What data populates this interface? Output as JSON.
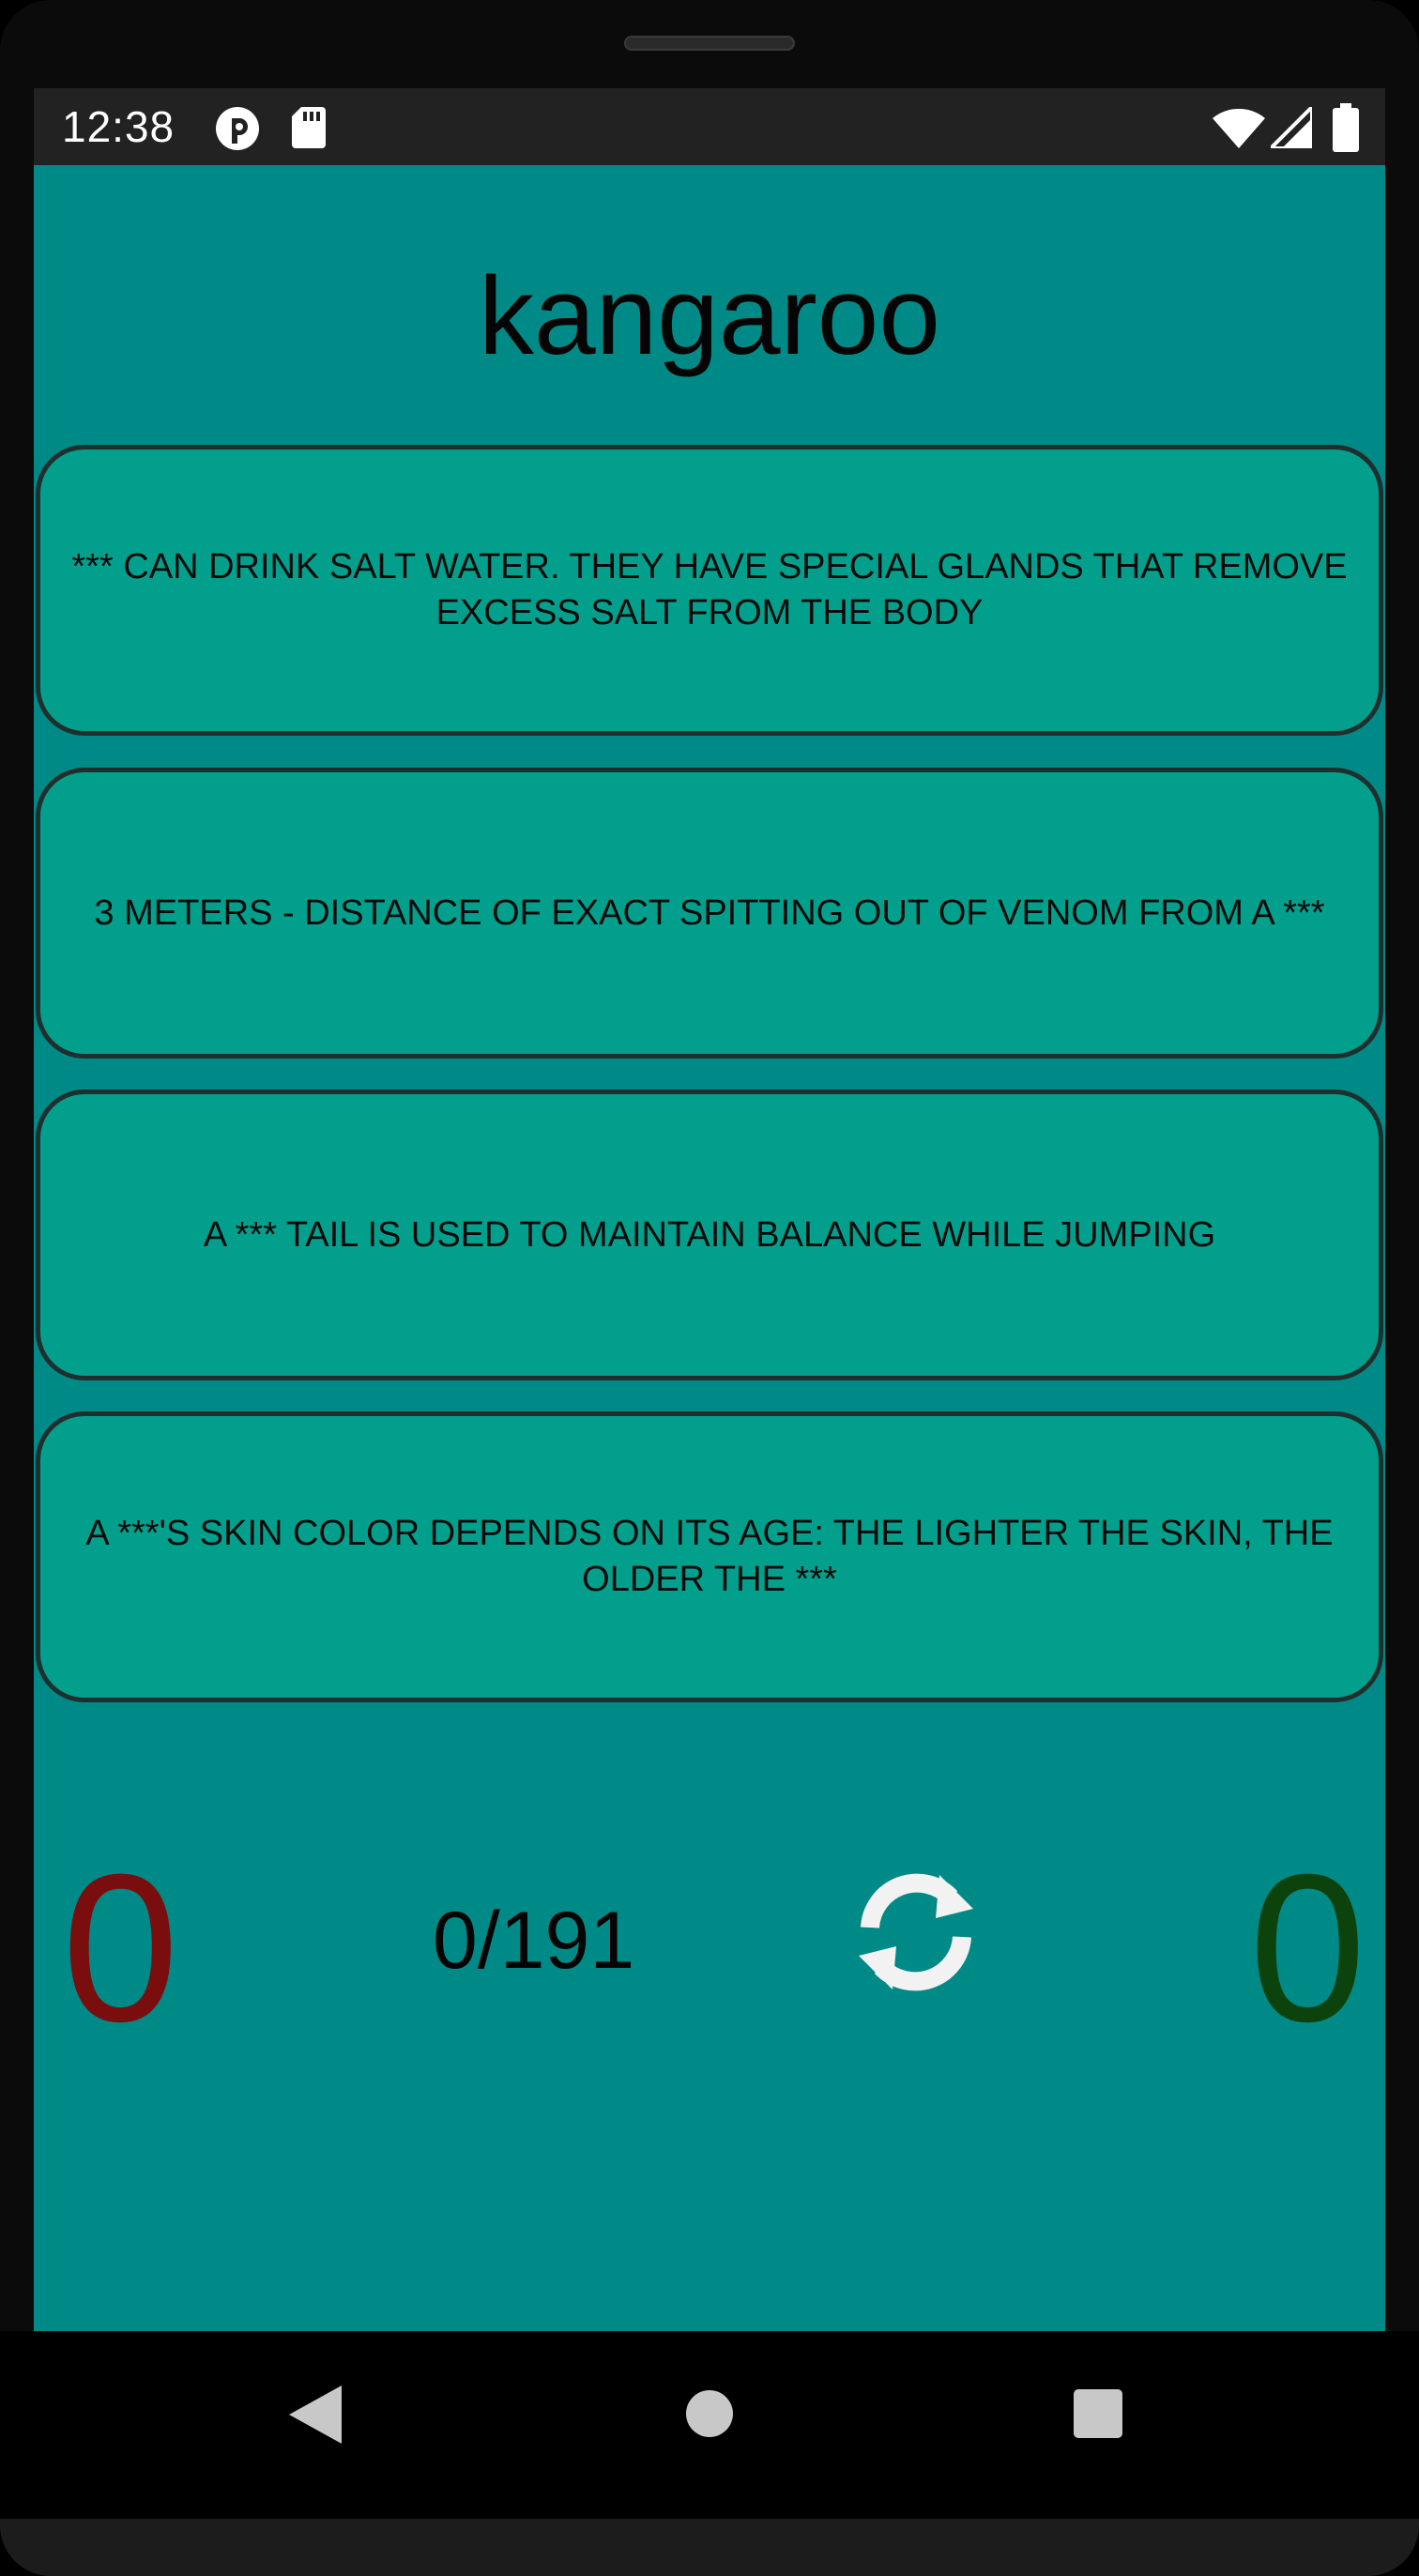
{
  "status_bar": {
    "time": "12:38",
    "icons": [
      "app-notification-icon",
      "sd-card-icon",
      "wifi-icon",
      "cell-signal-icon",
      "battery-icon"
    ]
  },
  "quiz": {
    "title": "kangaroo",
    "facts": [
      "*** can drink salt water. They have special glands that remove excess salt from the body",
      "3 meters - distance of exact spitting out of venom from a ***",
      "A *** tail is used to maintain balance while jumping",
      "A ***'s skin color depends on its age: the lighter the skin, the older the ***"
    ],
    "score_wrong": "0",
    "score_right": "0",
    "progress": "0/191",
    "refresh_icon": "refresh-icon"
  },
  "navigation": {
    "buttons": [
      "back-icon",
      "home-icon",
      "recents-icon"
    ]
  },
  "colors": {
    "background": "#008a87",
    "card": "#02a08c",
    "card_border": "#1f2f2e",
    "score_wrong": "#7a0e0e",
    "score_right": "#0c430c",
    "status_bar": "#222222"
  }
}
